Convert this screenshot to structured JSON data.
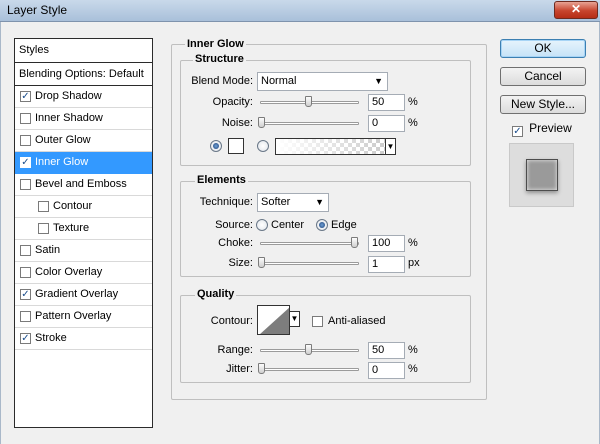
{
  "window": {
    "title": "Layer Style"
  },
  "styles_panel": {
    "header": "Styles",
    "blending_options": "Blending Options: Default",
    "items": [
      {
        "label": "Drop Shadow",
        "checked": true,
        "selected": false,
        "indent": false
      },
      {
        "label": "Inner Shadow",
        "checked": false,
        "selected": false,
        "indent": false
      },
      {
        "label": "Outer Glow",
        "checked": false,
        "selected": false,
        "indent": false
      },
      {
        "label": "Inner Glow",
        "checked": true,
        "selected": true,
        "indent": false
      },
      {
        "label": "Bevel and Emboss",
        "checked": false,
        "selected": false,
        "indent": false
      },
      {
        "label": "Contour",
        "checked": false,
        "selected": false,
        "indent": true
      },
      {
        "label": "Texture",
        "checked": false,
        "selected": false,
        "indent": true
      },
      {
        "label": "Satin",
        "checked": false,
        "selected": false,
        "indent": false
      },
      {
        "label": "Color Overlay",
        "checked": false,
        "selected": false,
        "indent": false
      },
      {
        "label": "Gradient Overlay",
        "checked": true,
        "selected": false,
        "indent": false
      },
      {
        "label": "Pattern Overlay",
        "checked": false,
        "selected": false,
        "indent": false
      },
      {
        "label": "Stroke",
        "checked": true,
        "selected": false,
        "indent": false
      }
    ]
  },
  "inner_glow": {
    "title": "Inner Glow",
    "structure": {
      "title": "Structure",
      "blend_mode_label": "Blend Mode:",
      "blend_mode_value": "Normal",
      "opacity_label": "Opacity:",
      "opacity_value": "50",
      "opacity_unit": "%",
      "opacity_level": 0.5,
      "noise_label": "Noise:",
      "noise_value": "0",
      "noise_unit": "%",
      "noise_level": 0.0,
      "color_mode": "solid"
    },
    "elements": {
      "title": "Elements",
      "technique_label": "Technique:",
      "technique_value": "Softer",
      "source_label": "Source:",
      "source_center": "Center",
      "source_edge": "Edge",
      "source_selected": "Edge",
      "choke_label": "Choke:",
      "choke_value": "100",
      "choke_unit": "%",
      "choke_level": 1.0,
      "size_label": "Size:",
      "size_value": "1",
      "size_unit": "px",
      "size_level": 0.0
    },
    "quality": {
      "title": "Quality",
      "contour_label": "Contour:",
      "anti_aliased_label": "Anti-aliased",
      "anti_aliased": false,
      "range_label": "Range:",
      "range_value": "50",
      "range_unit": "%",
      "range_level": 0.5,
      "jitter_label": "Jitter:",
      "jitter_value": "0",
      "jitter_unit": "%",
      "jitter_level": 0.0
    }
  },
  "buttons": {
    "ok": "OK",
    "cancel": "Cancel",
    "new_style": "New Style...",
    "preview_label": "Preview",
    "preview_checked": true
  },
  "icons": {
    "close": "close-icon",
    "dropdown": "chevron-down-icon"
  },
  "colors": {
    "selection": "#3399ff",
    "glow_color": "#ffffff",
    "close_button": "#c7442d"
  }
}
